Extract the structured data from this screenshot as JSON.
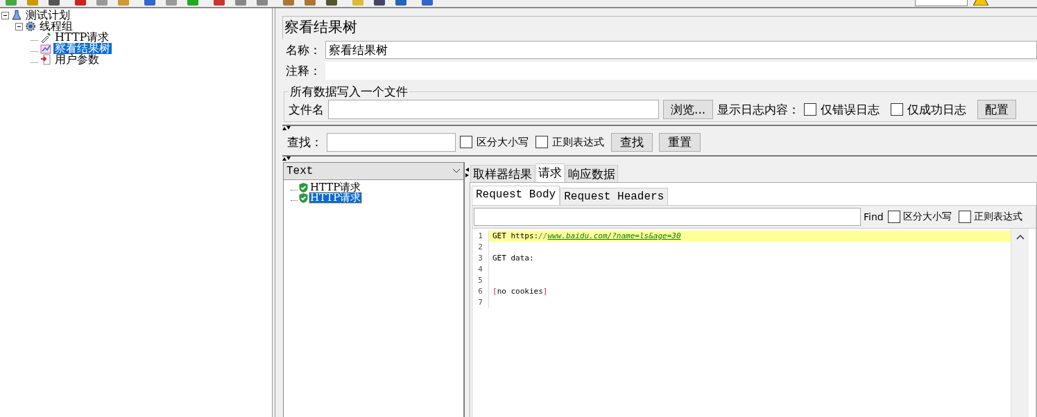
{
  "test_tree": [
    {
      "label": "测试计划",
      "kind": "plan",
      "selected": false,
      "expanded": true,
      "children": [
        {
          "label": "线程组",
          "kind": "threads",
          "selected": false,
          "expanded": true,
          "children": [
            {
              "label": "HTTP请求",
              "kind": "sampler",
              "selected": false
            },
            {
              "label": "察看结果树",
              "kind": "listener",
              "selected": true
            },
            {
              "label": "用户参数",
              "kind": "preprocessor",
              "selected": false
            }
          ]
        }
      ]
    }
  ],
  "panel": {
    "title": "察看结果树",
    "name": {
      "label": "名称：",
      "value": "察看结果树"
    },
    "comments": {
      "label": "注释："
    },
    "file_group": {
      "legend": "所有数据写入一个文件",
      "file_label": "文件名",
      "browse_button": "浏览...",
      "log_label": "显示日志内容：",
      "checkboxes": [
        {
          "label": "仅错误日志",
          "checked": false
        },
        {
          "label": "仅成功日志",
          "checked": false
        }
      ],
      "config_button": "配置"
    },
    "search": {
      "label": "查找：",
      "checkboxes": [
        {
          "label": "区分大小写",
          "checked": false
        },
        {
          "label": "正则表达式",
          "checked": false
        }
      ],
      "buttons": [
        "查找",
        "重置"
      ]
    },
    "renderer": {
      "value": "Text"
    },
    "results": [
      {
        "label": "HTTP请求",
        "selected": false
      },
      {
        "label": "HTTP请求",
        "selected": true
      }
    ],
    "tabs": [
      {
        "label": "取样器结果",
        "selected": false
      },
      {
        "label": "请求",
        "selected": true
      },
      {
        "label": "响应数据",
        "selected": false
      }
    ],
    "subtabs": [
      {
        "label": "Request Body",
        "selected": true
      },
      {
        "label": "Request Headers",
        "selected": false
      }
    ],
    "find": {
      "label": "Find",
      "checkboxes": [
        {
          "label": "区分大小写",
          "checked": false
        },
        {
          "label": "正则表达式",
          "checked": false
        }
      ]
    },
    "code_lines": [
      {
        "number": "1",
        "highlighted": true,
        "segments": [
          {
            "kind": "plain",
            "text": "GET https:"
          },
          {
            "kind": "comment",
            "text": "//"
          },
          {
            "kind": "link",
            "text": "www.baidu.com/?name=ls&age=30"
          }
        ]
      },
      {
        "number": "2",
        "highlighted": false
      },
      {
        "number": "3",
        "highlighted": false,
        "segments": [
          {
            "kind": "plain",
            "text": "GET data:"
          }
        ]
      },
      {
        "number": "4",
        "highlighted": false
      },
      {
        "number": "5",
        "highlighted": false
      },
      {
        "number": "6",
        "highlighted": false,
        "segments": [
          {
            "kind": "bracket",
            "text": "["
          },
          {
            "kind": "plain",
            "text": "no cookies"
          },
          {
            "kind": "bracket",
            "text": "]"
          }
        ]
      },
      {
        "number": "7",
        "highlighted": false
      }
    ]
  }
}
